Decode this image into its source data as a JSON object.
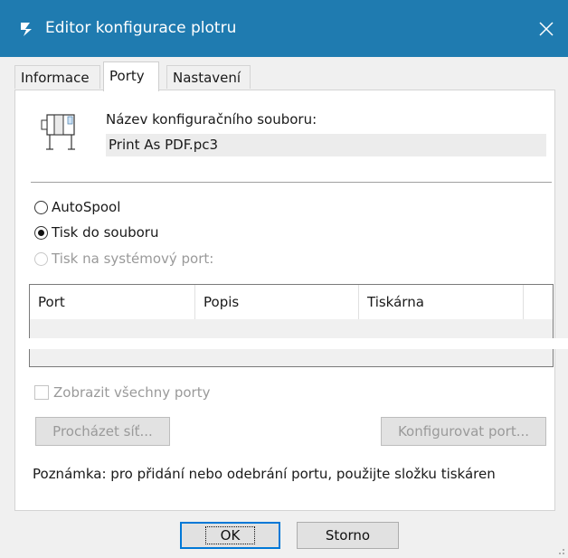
{
  "window": {
    "title": "Editor konfigurace plotru",
    "app_icon": "bricscad-logo",
    "close_icon": "close-icon"
  },
  "tabs": [
    {
      "label": "Informace",
      "active": false
    },
    {
      "label": "Porty",
      "active": true
    },
    {
      "label": "Nastavení",
      "active": false
    }
  ],
  "config": {
    "icon": "plotter-icon",
    "label": "Název konfiguračního souboru:",
    "value": "Print As PDF.pc3"
  },
  "port_options": [
    {
      "label": "AutoSpool",
      "checked": false,
      "enabled": true
    },
    {
      "label": "Tisk do souboru",
      "checked": true,
      "enabled": true
    },
    {
      "label": "Tisk na systémový port:",
      "checked": false,
      "enabled": false
    }
  ],
  "port_table": {
    "columns": [
      "Port",
      "Popis",
      "Tiskárna"
    ],
    "rows": []
  },
  "show_all_ports": {
    "label": "Zobrazit všechny porty",
    "checked": false,
    "enabled": false
  },
  "buttons": {
    "browse_network": "Procházet síť...",
    "configure_port": "Konfigurovat port...",
    "ok": "OK",
    "cancel": "Storno"
  },
  "note": "Poznámka: pro přidání nebo odebrání portu, použijte složku tiskáren",
  "colors": {
    "titlebar": "#1f7bb0",
    "accent": "#0078d7",
    "disabled_text": "#9a9a9a"
  }
}
